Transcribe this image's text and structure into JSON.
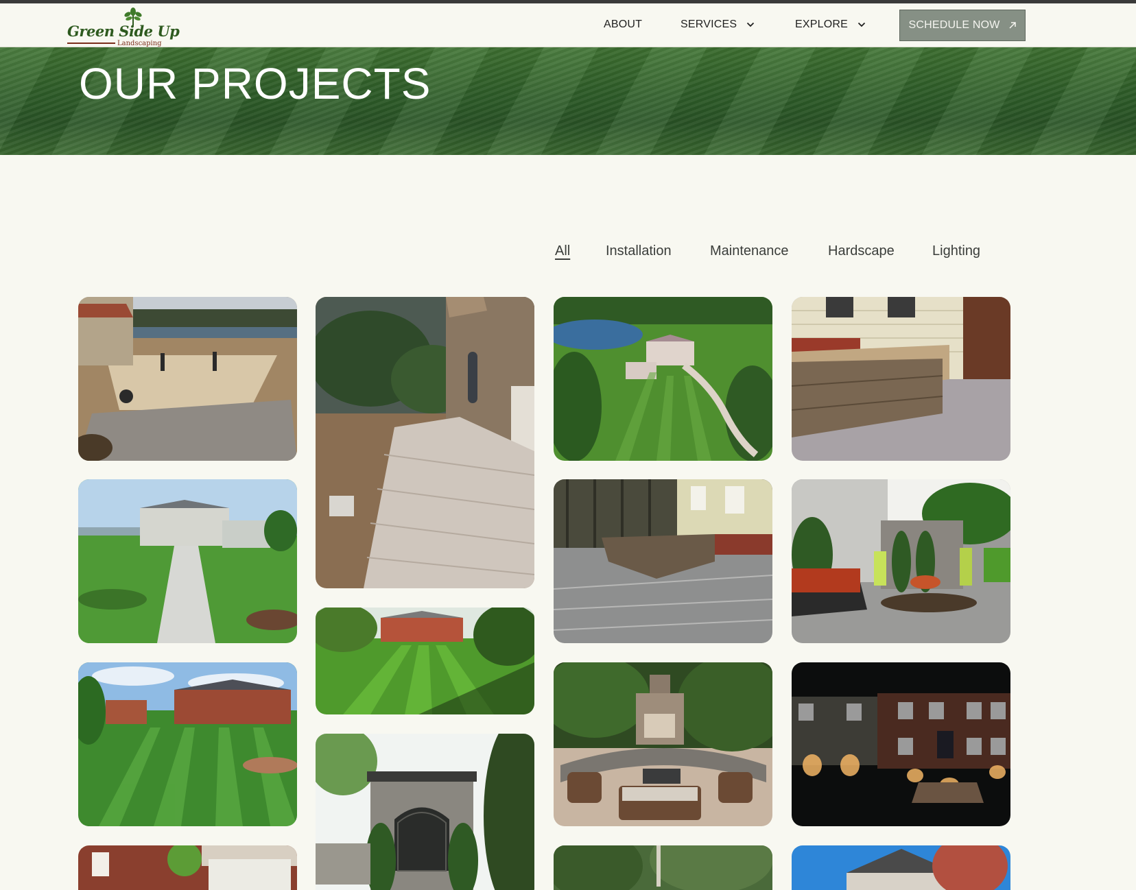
{
  "header": {
    "logo_text_main": "Green Side",
    "logo_text_up": "Up",
    "logo_sub": "Landscaping",
    "nav": [
      {
        "label": "ABOUT",
        "has_menu": false
      },
      {
        "label": "SERVICES",
        "has_menu": true
      },
      {
        "label": "EXPLORE",
        "has_menu": true
      }
    ],
    "cta_label": "SCHEDULE NOW",
    "cta_icon": "arrow-up-right-icon"
  },
  "hero": {
    "title": "OUR PROJECTS"
  },
  "filters": {
    "items": [
      "All",
      "Installation",
      "Maintenance",
      "Hardscape",
      "Lighting"
    ],
    "active": "All"
  },
  "gallery": {
    "items": [
      {
        "scene": "patio-construction-lake"
      },
      {
        "scene": "paver-walkway-stone-house"
      },
      {
        "scene": "aerial-estate-lawn"
      },
      {
        "scene": "stone-outdoor-kitchen"
      },
      {
        "scene": "estate-front-walkway"
      },
      {
        "scene": "paver-patio-stone-bar"
      },
      {
        "scene": "crew-stone-wall-install"
      },
      {
        "scene": "striped-backyard-lawn"
      },
      {
        "scene": "striped-lawn-brick-houses"
      },
      {
        "scene": "stone-archway-gate"
      },
      {
        "scene": "outdoor-fireplace-patio"
      },
      {
        "scene": "night-lighting-brick-house"
      },
      {
        "scene": "brick-house-porch"
      },
      {
        "scene": "trees-backyard"
      },
      {
        "scene": "house-blue-sky-red-tree"
      }
    ]
  }
}
